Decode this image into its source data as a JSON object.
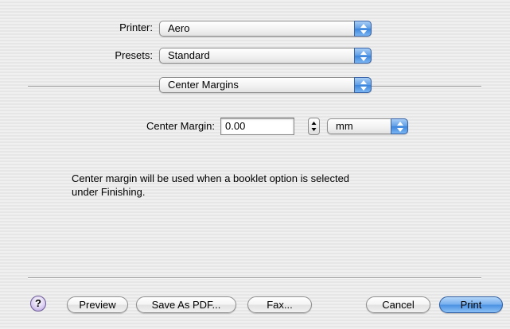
{
  "printer": {
    "label": "Printer:",
    "value": "Aero"
  },
  "presets": {
    "label": "Presets:",
    "value": "Standard"
  },
  "pane_selector": {
    "value": "Center Margins"
  },
  "center_margin": {
    "label": "Center Margin:",
    "value": "0.00",
    "unit": "mm"
  },
  "description": {
    "line1": "Center margin will be used when a booklet option is selected",
    "line2": "under Finishing."
  },
  "buttons": {
    "help": "?",
    "preview": "Preview",
    "save_pdf": "Save As PDF...",
    "fax": "Fax...",
    "cancel": "Cancel",
    "print": "Print"
  },
  "icons": {
    "popup_arrows": "up-down-arrows-icon",
    "stepper": "stepper-icon",
    "help": "help-icon"
  },
  "colors": {
    "accent_blue": "#4a90e2",
    "background": "#ececec"
  }
}
